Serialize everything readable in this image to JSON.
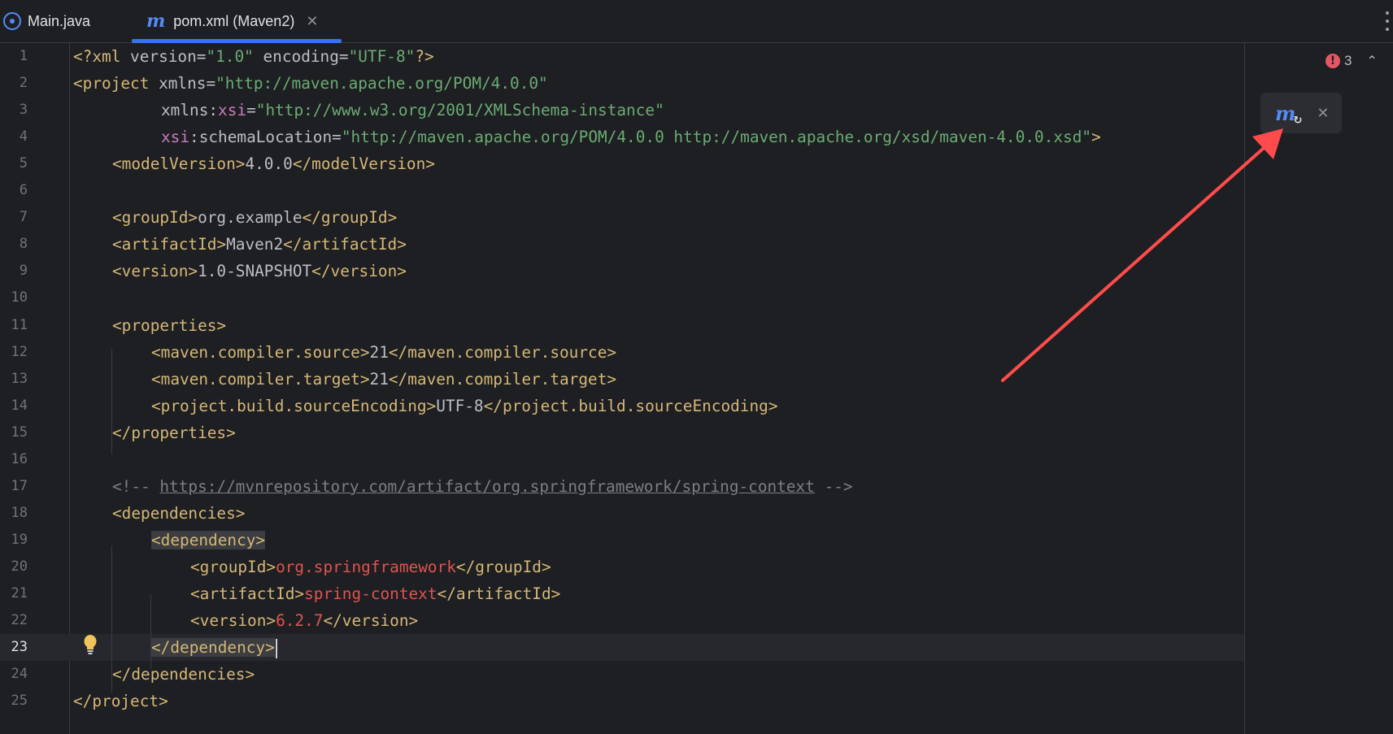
{
  "tabs": [
    {
      "label": "Main.java",
      "icon": "java-class-icon",
      "active": false
    },
    {
      "label": "pom.xml (Maven2)",
      "icon": "maven-icon",
      "active": true
    }
  ],
  "tab_close_glyph": "✕",
  "inspection": {
    "error_count": "3",
    "error_glyph": "!",
    "chevron_glyph": "⌃"
  },
  "maven_popup": {
    "icon_glyph": "m",
    "refresh_glyph": "↻",
    "close_glyph": "✕"
  },
  "current_line": 23,
  "colors": {
    "background": "#1e1f22",
    "tag": "#d5b778",
    "string": "#6aab73",
    "namespace": "#c77dbb",
    "value_red": "#e0534f",
    "comment": "#7a7e85",
    "accent": "#3574f0",
    "arrow": "#ff4b4b"
  },
  "lines": [
    {
      "n": "1",
      "indent": 0,
      "tokens": [
        [
          "tag",
          "<?xml "
        ],
        [
          "attr",
          "version="
        ],
        [
          "str",
          "\"1.0\""
        ],
        [
          "attr",
          " encoding="
        ],
        [
          "str",
          "\"UTF-8\""
        ],
        [
          "tag",
          "?>"
        ]
      ]
    },
    {
      "n": "2",
      "indent": 0,
      "tokens": [
        [
          "tag",
          "<project "
        ],
        [
          "attr",
          "xmlns="
        ],
        [
          "str",
          "\"http://maven.apache.org/POM/4.0.0\""
        ]
      ]
    },
    {
      "n": "3",
      "indent": 9,
      "tokens": [
        [
          "attr",
          "xmlns:"
        ],
        [
          "ns",
          "xsi"
        ],
        [
          "attr",
          "="
        ],
        [
          "str",
          "\"http://www.w3.org/2001/XMLSchema-instance\""
        ]
      ]
    },
    {
      "n": "4",
      "indent": 9,
      "tokens": [
        [
          "ns",
          "xsi"
        ],
        [
          "attr",
          ":schemaLocation="
        ],
        [
          "str",
          "\"http://maven.apache.org/POM/4.0.0 http://maven.apache.org/xsd/maven-4.0.0.xsd\""
        ],
        [
          "tag",
          ">"
        ]
      ]
    },
    {
      "n": "5",
      "indent": 4,
      "tokens": [
        [
          "tag",
          "<modelVersion>"
        ],
        [
          "txt",
          "4.0.0"
        ],
        [
          "tag",
          "</modelVersion>"
        ]
      ]
    },
    {
      "n": "6",
      "indent": 0,
      "tokens": []
    },
    {
      "n": "7",
      "indent": 4,
      "tokens": [
        [
          "tag",
          "<groupId>"
        ],
        [
          "txt",
          "org.example"
        ],
        [
          "tag",
          "</groupId>"
        ]
      ]
    },
    {
      "n": "8",
      "indent": 4,
      "tokens": [
        [
          "tag",
          "<artifactId>"
        ],
        [
          "txt",
          "Maven2"
        ],
        [
          "tag",
          "</artifactId>"
        ]
      ]
    },
    {
      "n": "9",
      "indent": 4,
      "tokens": [
        [
          "tag",
          "<version>"
        ],
        [
          "txt",
          "1.0-SNAPSHOT"
        ],
        [
          "tag",
          "</version>"
        ]
      ]
    },
    {
      "n": "10",
      "indent": 0,
      "tokens": []
    },
    {
      "n": "11",
      "indent": 4,
      "tokens": [
        [
          "tag",
          "<properties>"
        ]
      ]
    },
    {
      "n": "12",
      "indent": 8,
      "tokens": [
        [
          "tag",
          "<maven.compiler.source>"
        ],
        [
          "txt",
          "21"
        ],
        [
          "tag",
          "</maven.compiler.source>"
        ]
      ]
    },
    {
      "n": "13",
      "indent": 8,
      "tokens": [
        [
          "tag",
          "<maven.compiler.target>"
        ],
        [
          "txt",
          "21"
        ],
        [
          "tag",
          "</maven.compiler.target>"
        ]
      ]
    },
    {
      "n": "14",
      "indent": 8,
      "tokens": [
        [
          "tag",
          "<project.build.sourceEncoding>"
        ],
        [
          "txt",
          "UTF-8"
        ],
        [
          "tag",
          "</project.build.sourceEncoding>"
        ]
      ]
    },
    {
      "n": "15",
      "indent": 4,
      "tokens": [
        [
          "tag",
          "</properties>"
        ]
      ]
    },
    {
      "n": "16",
      "indent": 0,
      "tokens": []
    },
    {
      "n": "17",
      "indent": 4,
      "tokens": [
        [
          "comment",
          "<!-- "
        ],
        [
          "link",
          "https://mvnrepository.com/artifact/org.springframework/spring-context"
        ],
        [
          "comment",
          " -->"
        ]
      ]
    },
    {
      "n": "18",
      "indent": 4,
      "tokens": [
        [
          "tag",
          "<dependencies>"
        ]
      ]
    },
    {
      "n": "19",
      "indent": 8,
      "tokens": [
        [
          "tag hl",
          "<dependency>"
        ]
      ]
    },
    {
      "n": "20",
      "indent": 12,
      "tokens": [
        [
          "tag",
          "<groupId>"
        ],
        [
          "red",
          "org.springframework"
        ],
        [
          "tag",
          "</groupId>"
        ]
      ]
    },
    {
      "n": "21",
      "indent": 12,
      "tokens": [
        [
          "tag",
          "<artifactId>"
        ],
        [
          "red",
          "spring-context"
        ],
        [
          "tag",
          "</artifactId>"
        ]
      ]
    },
    {
      "n": "22",
      "indent": 12,
      "tokens": [
        [
          "tag",
          "<version>"
        ],
        [
          "red",
          "6.2.7"
        ],
        [
          "tag",
          "</version>"
        ]
      ]
    },
    {
      "n": "23",
      "indent": 8,
      "tokens": [
        [
          "tag hl",
          "</dependency>"
        ]
      ],
      "caret": true
    },
    {
      "n": "24",
      "indent": 4,
      "tokens": [
        [
          "tag",
          "</dependencies>"
        ]
      ]
    },
    {
      "n": "25",
      "indent": 0,
      "tokens": [
        [
          "tag",
          "</project>"
        ]
      ]
    }
  ]
}
